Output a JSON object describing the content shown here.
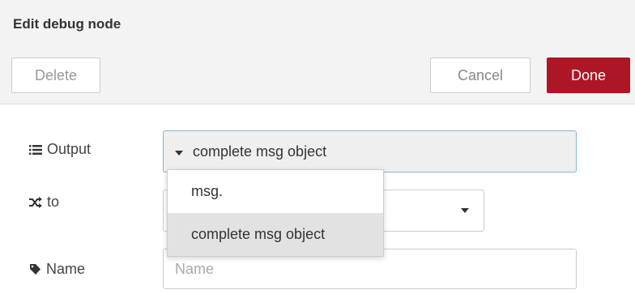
{
  "dialog": {
    "title": "Edit debug node"
  },
  "toolbar": {
    "delete_label": "Delete",
    "cancel_label": "Cancel",
    "done_label": "Done"
  },
  "colors": {
    "done_bg": "#ad1625",
    "focus_border": "#85b4d6",
    "header_bg": "#f3f3f3"
  },
  "form": {
    "output": {
      "label": "Output",
      "icon": "list-icon",
      "value": "complete msg object"
    },
    "to": {
      "label": "to",
      "icon": "shuffle-icon",
      "value": ""
    },
    "name": {
      "label": "Name",
      "icon": "tag-icon",
      "placeholder": "Name",
      "value": ""
    }
  },
  "dropdown": {
    "items": [
      {
        "label": "msg.",
        "selected": false
      },
      {
        "label": "complete msg object",
        "selected": true
      }
    ]
  }
}
